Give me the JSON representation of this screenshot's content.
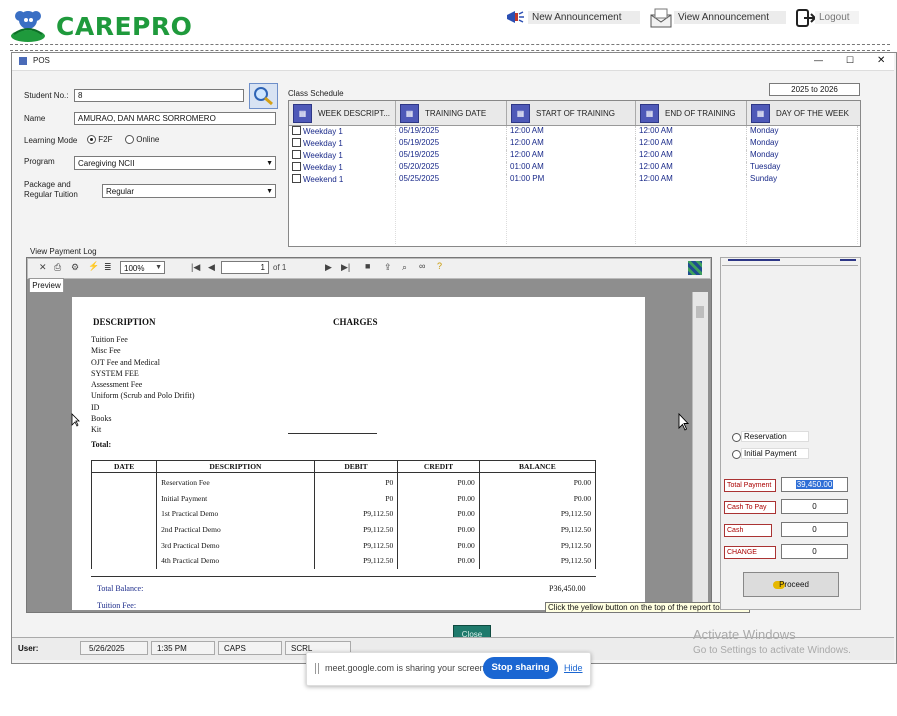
{
  "app": {
    "brand": "CAREPRO",
    "new_announcement": "New Announcement",
    "view_announcement": "View Announcement",
    "logout": "Logout"
  },
  "window": {
    "title": "POS",
    "min": "—",
    "max": "☐",
    "close": "✕"
  },
  "student": {
    "no_label": "Student No.:",
    "no_value": "8",
    "name_label": "Name",
    "name_value": "AMURAO, DAN MARC SORROMERO",
    "mode_label": "Learning Mode",
    "mode_f2f": "F2F",
    "mode_online": "Online",
    "program_label": "Program",
    "program_value": "Caregiving NCII",
    "package_label": "Package and Regular Tuition",
    "package_value": "Regular"
  },
  "schedule": {
    "label": "Class Schedule",
    "date_range": "2025 to 2026",
    "columns": [
      "WEEK DESCRIPT...",
      "TRAINING DATE",
      "START OF TRAINING",
      "END OF TRAINING",
      "DAY OF THE WEEK"
    ],
    "rows": [
      [
        "Weekday 1",
        "05/19/2025",
        "12:00 AM",
        "12:00 AM",
        "Monday"
      ],
      [
        "Weekday 1",
        "05/19/2025",
        "12:00 AM",
        "12:00 AM",
        "Monday"
      ],
      [
        "Weekday 1",
        "05/19/2025",
        "12:00 AM",
        "12:00 AM",
        "Monday"
      ],
      [
        "Weekday 1",
        "05/20/2025",
        "01:00 AM",
        "12:00 AM",
        "Tuesday"
      ],
      [
        "Weekend 1",
        "05/25/2025",
        "01:00 PM",
        "12:00 AM",
        "Sunday"
      ]
    ]
  },
  "report": {
    "log_label": "View Payment Log",
    "zoom": "100%",
    "page_current": "1",
    "page_of": "of 1",
    "preview_tab": "Preview",
    "desc_header": "DESCRIPTION",
    "charges_header": "CHARGES",
    "items": [
      "Tuition Fee",
      "Misc Fee",
      "OJT Fee and Medical",
      "SYSTEM FEE",
      "Assessment Fee",
      "Uniform (Scrub and Polo Drifit)",
      "ID",
      "Books",
      "Kit"
    ],
    "total_label": "Total:",
    "ledger_headers": [
      "DATE",
      "DESCRIPTION",
      "DEBIT",
      "CREDIT",
      "BALANCE"
    ],
    "ledger_rows": [
      [
        "",
        "Reservation Fee",
        "P0",
        "P0.00",
        "P0.00"
      ],
      [
        "",
        "Initial Payment",
        "P0",
        "P0.00",
        "P0.00"
      ],
      [
        "",
        "1st Practical Demo",
        "P9,112.50",
        "P0.00",
        "P9,112.50"
      ],
      [
        "",
        "2nd Practical Demo",
        "P9,112.50",
        "P0.00",
        "P9,112.50"
      ],
      [
        "",
        "3rd Practical Demo",
        "P9,112.50",
        "P0.00",
        "P9,112.50"
      ],
      [
        "",
        "4th Practical Demo",
        "P9,112.50",
        "P0.00",
        "P9,112.50"
      ]
    ],
    "total_balance_label": "Total Balance:",
    "total_balance_value": "P36,450.00",
    "tuition_fee_label": "Tuition Fee:",
    "tooltip": "Click the yellow button on the top of the report to refresh"
  },
  "payment": {
    "reservation": "Reservation",
    "initial_payment": "Initial Payment",
    "total_payment_label": "Total Payment",
    "total_payment_value": "39,450.00",
    "cash_to_pay_label": "Cash To Pay",
    "cash_to_pay_value": "0",
    "cash_label": "Cash",
    "cash_value": "0",
    "change_label": "CHANGE",
    "change_value": "0",
    "proceed": "Proceed"
  },
  "footer": {
    "close": "Close",
    "user_label": "User:",
    "date": "5/26/2025",
    "time": "1:35 PM",
    "caps": "CAPS",
    "scrl": "SCRL"
  },
  "share_bar": {
    "message": "meet.google.com is sharing your screen.",
    "stop": "Stop sharing",
    "hide": "Hide"
  },
  "watermark": {
    "title": "Activate Windows",
    "subtitle": "Go to Settings to activate Windows."
  },
  "colors": {
    "brand_green": "#1f9a3c",
    "grid_text": "#1a2a8a",
    "stop_blue": "#1a66d2",
    "close_teal": "#1f7a6c"
  }
}
